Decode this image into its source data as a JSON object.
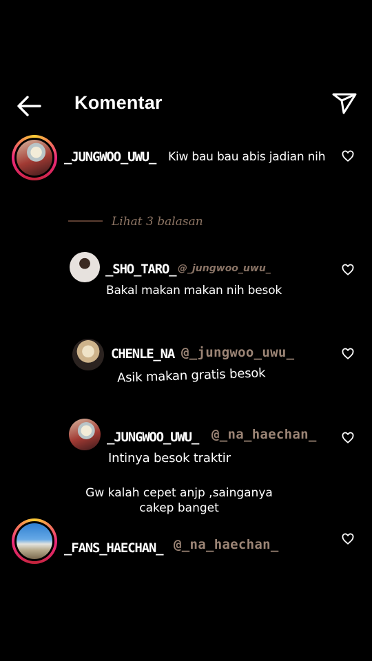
{
  "header": {
    "back_icon": "arrow-left-icon",
    "title": "Komentar",
    "send_icon": "paper-plane-icon"
  },
  "main_comment": {
    "username": "_JUNGWOO_UWU_",
    "text": "Kiw bau bau abis jadian nih"
  },
  "replies_toggle": {
    "label": "Lihat 3 balasan"
  },
  "replies": [
    {
      "username": "_SHO_TARO_",
      "mention": "@_jungwoo_uwu_",
      "text": "Bakal makan makan nih besok"
    },
    {
      "username": "CHENLE_NA",
      "mention": "@_jungwoo_uwu_",
      "text": "Asik makan gratis besok"
    },
    {
      "username": "_JUNGWOO_UWU_",
      "mention": "@_na_haechan_",
      "text": "Intinya besok traktir"
    }
  ],
  "floating_caption": {
    "line1": "Gw kalah cepet anjp ,sainganya",
    "line2": "cakep banget"
  },
  "last_comment": {
    "username": "_FANS_HAECHAN_",
    "mention": "@_na_haechan_"
  },
  "colors": {
    "background": "#000000",
    "mention": "#9b8475",
    "story_ring": "#ee2a7b"
  }
}
